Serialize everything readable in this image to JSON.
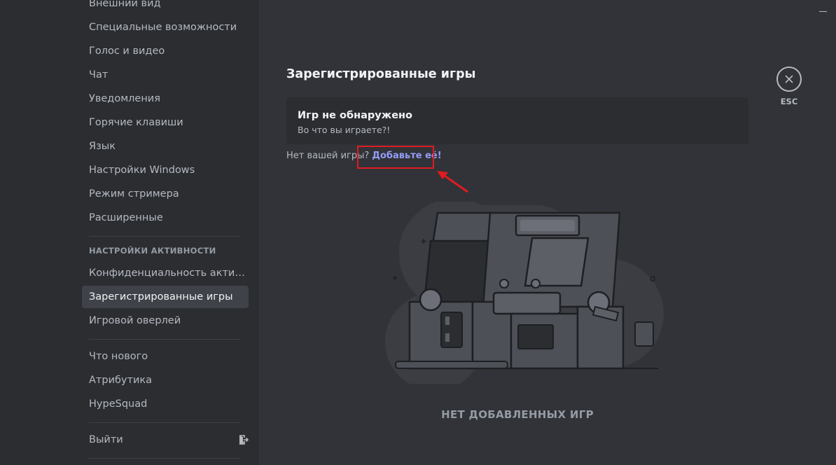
{
  "sidebar": {
    "items_top": [
      {
        "label": "Внешний вид"
      },
      {
        "label": "Специальные возможности"
      },
      {
        "label": "Голос и видео"
      },
      {
        "label": "Чат"
      },
      {
        "label": "Уведомления"
      },
      {
        "label": "Горячие клавиши"
      },
      {
        "label": "Язык"
      },
      {
        "label": "Настройки Windows"
      },
      {
        "label": "Режим стримера"
      },
      {
        "label": "Расширенные"
      }
    ],
    "activity_header": "НАСТРОЙКИ АКТИВНОСТИ",
    "activity_items": [
      {
        "label": "Конфиденциальность активности",
        "active": false
      },
      {
        "label": "Зарегистрированные игры",
        "active": true
      },
      {
        "label": "Игровой оверлей",
        "active": false
      }
    ],
    "misc_items": [
      {
        "label": "Что нового"
      },
      {
        "label": "Атрибутика"
      },
      {
        "label": "HypeSquad"
      }
    ],
    "logout_label": "Выйти"
  },
  "main": {
    "title": "Зарегистрированные игры",
    "empty_card": {
      "title": "Игр не обнаружено",
      "subtitle": "Во что вы играете?!"
    },
    "add_prompt": "Нет вашей игры?",
    "add_link": "Добавьте её!",
    "empty_label": "НЕТ ДОБАВЛЕННЫХ ИГР"
  },
  "close": {
    "label": "ESC"
  },
  "colors": {
    "background": "#313338",
    "sidebar": "#2b2d31",
    "link": "#949cf7",
    "annotation": "#e01b22"
  }
}
